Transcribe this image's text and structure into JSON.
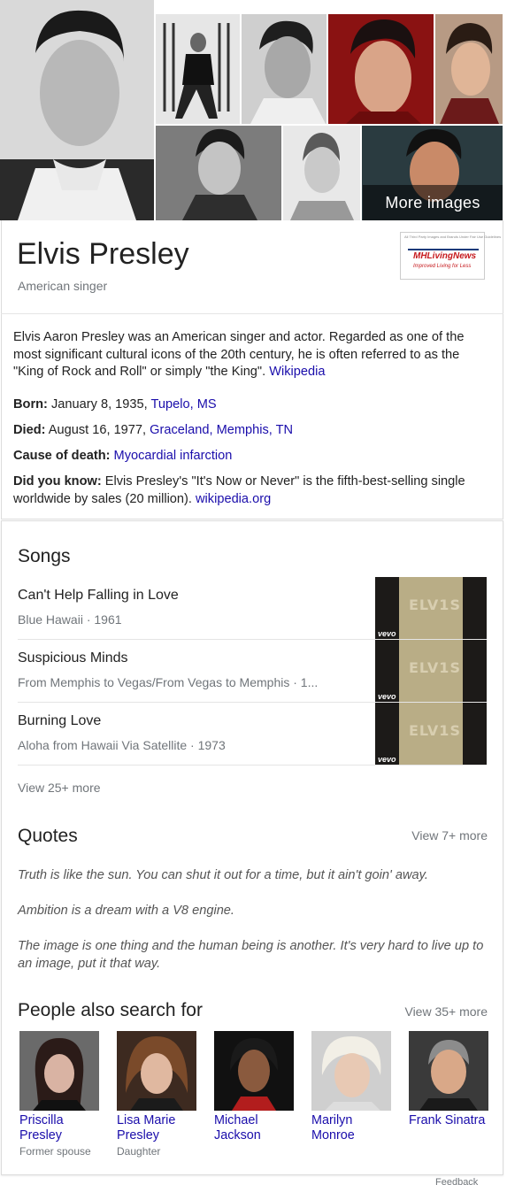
{
  "images": {
    "more_label": "More images"
  },
  "header": {
    "title": "Elvis Presley",
    "subtitle": "American singer"
  },
  "description": {
    "text": "Elvis Aaron Presley was an American singer and actor. Regarded as one of the most significant cultural icons of the 20th century, he is often referred to as the \"King of Rock and Roll\" or simply \"the King\". ",
    "source": "Wikipedia"
  },
  "facts": {
    "born_label": "Born:",
    "born_text": " January 8, 1935, ",
    "born_link": "Tupelo, MS",
    "died_label": "Died:",
    "died_text": " August 16, 1977, ",
    "died_link": "Graceland, Memphis, TN",
    "cause_label": "Cause of death:",
    "cause_link": "Myocardial infarction",
    "dyk_label": "Did you know:",
    "dyk_text": " Elvis Presley's \"It's Now or Never\" is the fifth-best-selling single worldwide by sales (20 million). ",
    "dyk_link": "wikipedia.org"
  },
  "songs": {
    "title": "Songs",
    "items": [
      {
        "name": "Can't Help Falling in Love",
        "meta": "Blue Hawaii · 1961"
      },
      {
        "name": "Suspicious Minds",
        "meta": "From Memphis to Vegas/From Vegas to Memphis · 1..."
      },
      {
        "name": "Burning Love",
        "meta": "Aloha from Hawaii Via Satellite · 1973"
      }
    ],
    "thumb_text": "ELV1S",
    "thumb_brand": "vevo",
    "view_more": "View 25+ more"
  },
  "quotes": {
    "title": "Quotes",
    "view_more": "View 7+ more",
    "items": [
      "Truth is like the sun. You can shut it out for a time, but it ain't goin' away.",
      "Ambition is a dream with a V8 engine.",
      "The image is one thing and the human being is another. It's very hard to live up to an image, put it that way."
    ]
  },
  "people": {
    "title": "People also search for",
    "view_more": "View 35+ more",
    "items": [
      {
        "name": "Priscilla Presley",
        "relation": "Former spouse"
      },
      {
        "name": "Lisa Marie Presley",
        "relation": "Daughter"
      },
      {
        "name": "Michael Jackson",
        "relation": ""
      },
      {
        "name": "Marilyn Monroe",
        "relation": ""
      },
      {
        "name": "Frank Sinatra",
        "relation": ""
      }
    ]
  },
  "footer": {
    "feedback": "Feedback"
  },
  "logo": {
    "name": "MHLivingNews",
    "tagline": "Improved Living for Less",
    "tiny": "All Third Party Images and Brands Under Fair Use Guidelines"
  }
}
